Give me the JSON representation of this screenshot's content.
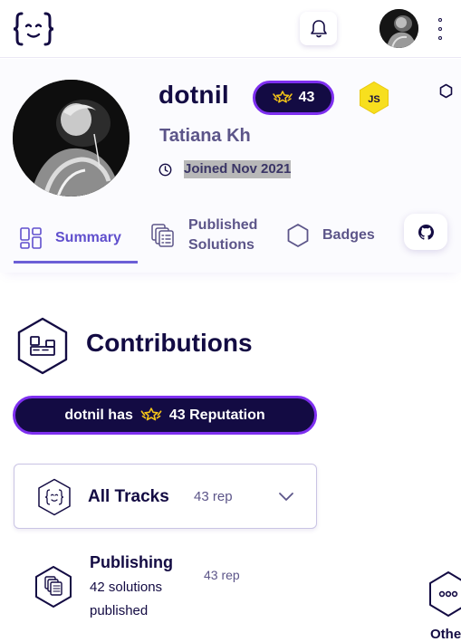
{
  "header": {
    "logo_icon": "exercism-logo-icon",
    "notifications_icon": "bell-icon",
    "avatar_alt": "user-avatar",
    "menu_icon": "kebab-menu-icon"
  },
  "profile": {
    "handle": "dotnil",
    "reputation": "43",
    "badge_language": "JS",
    "full_name": "Tatiana Kh",
    "joined": "Joined Nov 2021"
  },
  "tabs": [
    {
      "label": "Summary",
      "icon": "summary-grid-icon",
      "active": true
    },
    {
      "label": "Published Solutions",
      "line1": "Published",
      "line2": "Solutions",
      "icon": "published-solutions-icon",
      "active": false
    },
    {
      "label": "Badges",
      "icon": "hexagon-badge-icon",
      "active": false
    }
  ],
  "github_icon": "github-icon",
  "contributions": {
    "title": "Contributions",
    "rep_prefix": "dotnil has",
    "rep_text": "43 Reputation",
    "tracks": {
      "name": "All Tracks",
      "rep": "43 rep"
    },
    "categories": [
      {
        "title": "Publishing",
        "desc": "42 solutions published",
        "rep": "43 rep"
      },
      {
        "title": "Other"
      }
    ]
  },
  "colors": {
    "primary_dark": "#130b43",
    "accent_purple": "#7e2ff0",
    "tab_active": "#604fcd",
    "muted": "#5c5589",
    "js_yellow": "#f7df1e"
  }
}
